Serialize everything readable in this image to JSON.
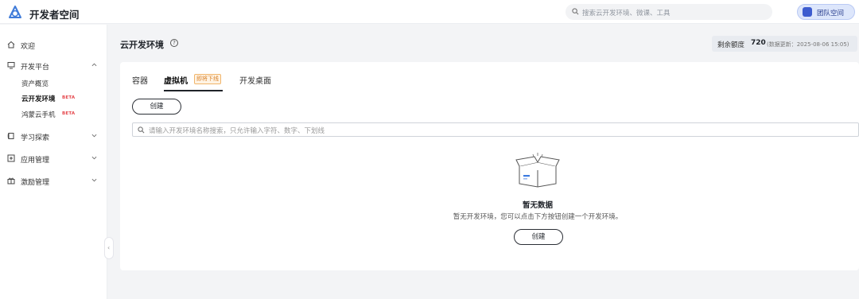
{
  "header": {
    "brand": "开发者空间",
    "search_placeholder": "搜索云开发环境、微课、工具",
    "team_label": "团队空间"
  },
  "sidebar": {
    "items": [
      {
        "label": "欢迎",
        "icon": "home-icon"
      },
      {
        "label": "开发平台",
        "icon": "monitor-icon",
        "expanded": true,
        "children": [
          {
            "label": "资产概览"
          },
          {
            "label": "云开发环境",
            "badge": "BETA",
            "active": true
          },
          {
            "label": "鸿蒙云手机",
            "badge": "BETA"
          }
        ]
      },
      {
        "label": "学习探索",
        "icon": "book-icon"
      },
      {
        "label": "应用管理",
        "icon": "apps-icon"
      },
      {
        "label": "激励管理",
        "icon": "gift-icon"
      }
    ],
    "collapse_glyph": "‹"
  },
  "page": {
    "title": "云开发环境",
    "help_glyph": "?",
    "quota_label": "剩余额度",
    "quota_value": "720",
    "quota_note": "(数据更新：2025-08-06 15:05)"
  },
  "tabs": [
    {
      "label": "容器"
    },
    {
      "label": "虚拟机",
      "badge": "即将下线",
      "active": true
    },
    {
      "label": "开发桌面"
    }
  ],
  "create_label": "创建",
  "filter_placeholder": "请输入开发环境名称搜索，只允许输入字符、数字、下划线",
  "empty": {
    "title": "暂无数据",
    "description": "暂无开发环境，您可以点击下方按钮创建一个开发环境。",
    "button": "创建"
  },
  "colors": {
    "accent": "#3d5ccf",
    "beta": "#e5484d",
    "badge_orange": "#d9822b"
  }
}
